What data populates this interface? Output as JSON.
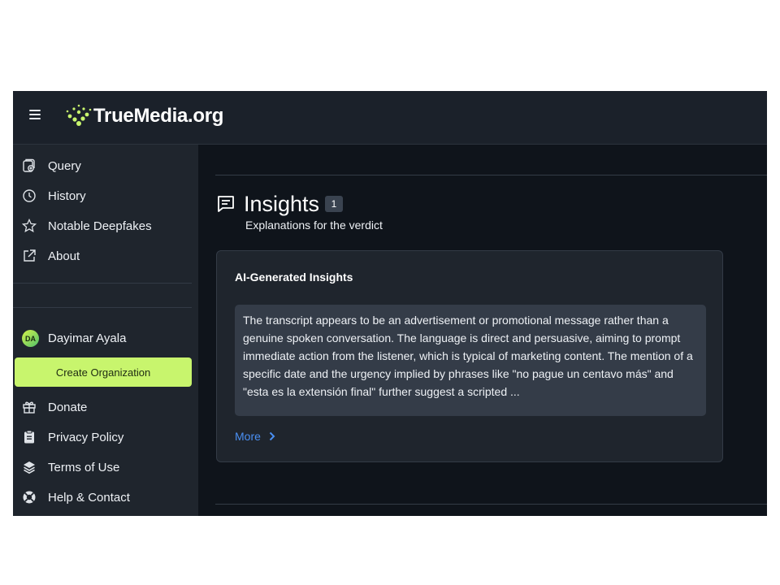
{
  "header": {
    "brand": "TrueMedia.org"
  },
  "sidebar": {
    "top_items": [
      {
        "label": "Query",
        "icon": "query-icon"
      },
      {
        "label": "History",
        "icon": "history-icon"
      },
      {
        "label": "Notable Deepfakes",
        "icon": "star-icon"
      },
      {
        "label": "About",
        "icon": "external-link-icon"
      }
    ],
    "user": {
      "initials": "DA",
      "name": "Dayimar Ayala"
    },
    "create_org_label": "Create Organization",
    "bottom_items": [
      {
        "label": "Donate",
        "icon": "gift-icon"
      },
      {
        "label": "Privacy Policy",
        "icon": "clipboard-icon"
      },
      {
        "label": "Terms of Use",
        "icon": "layers-icon"
      },
      {
        "label": "Help & Contact",
        "icon": "lifebuoy-icon"
      }
    ]
  },
  "insights": {
    "title": "Insights",
    "count": "1",
    "subtitle": "Explanations for the verdict",
    "card": {
      "title": "AI-Generated Insights",
      "text": "The transcript appears to be an advertisement or promotional message rather than a genuine spoken conversation. The language is direct and persuasive, aiming to prompt immediate action from the listener, which is typical of marketing content. The mention of a specific date and the urgency implied by phrases like \"no pague un centavo más\" and \"esta es la extensión final\" further suggest a scripted ...",
      "more_label": "More"
    }
  },
  "colors": {
    "accent_green": "#c8f56d",
    "link_blue": "#4a8ff2",
    "background": "#0f141b",
    "sidebar": "#1f252d"
  }
}
